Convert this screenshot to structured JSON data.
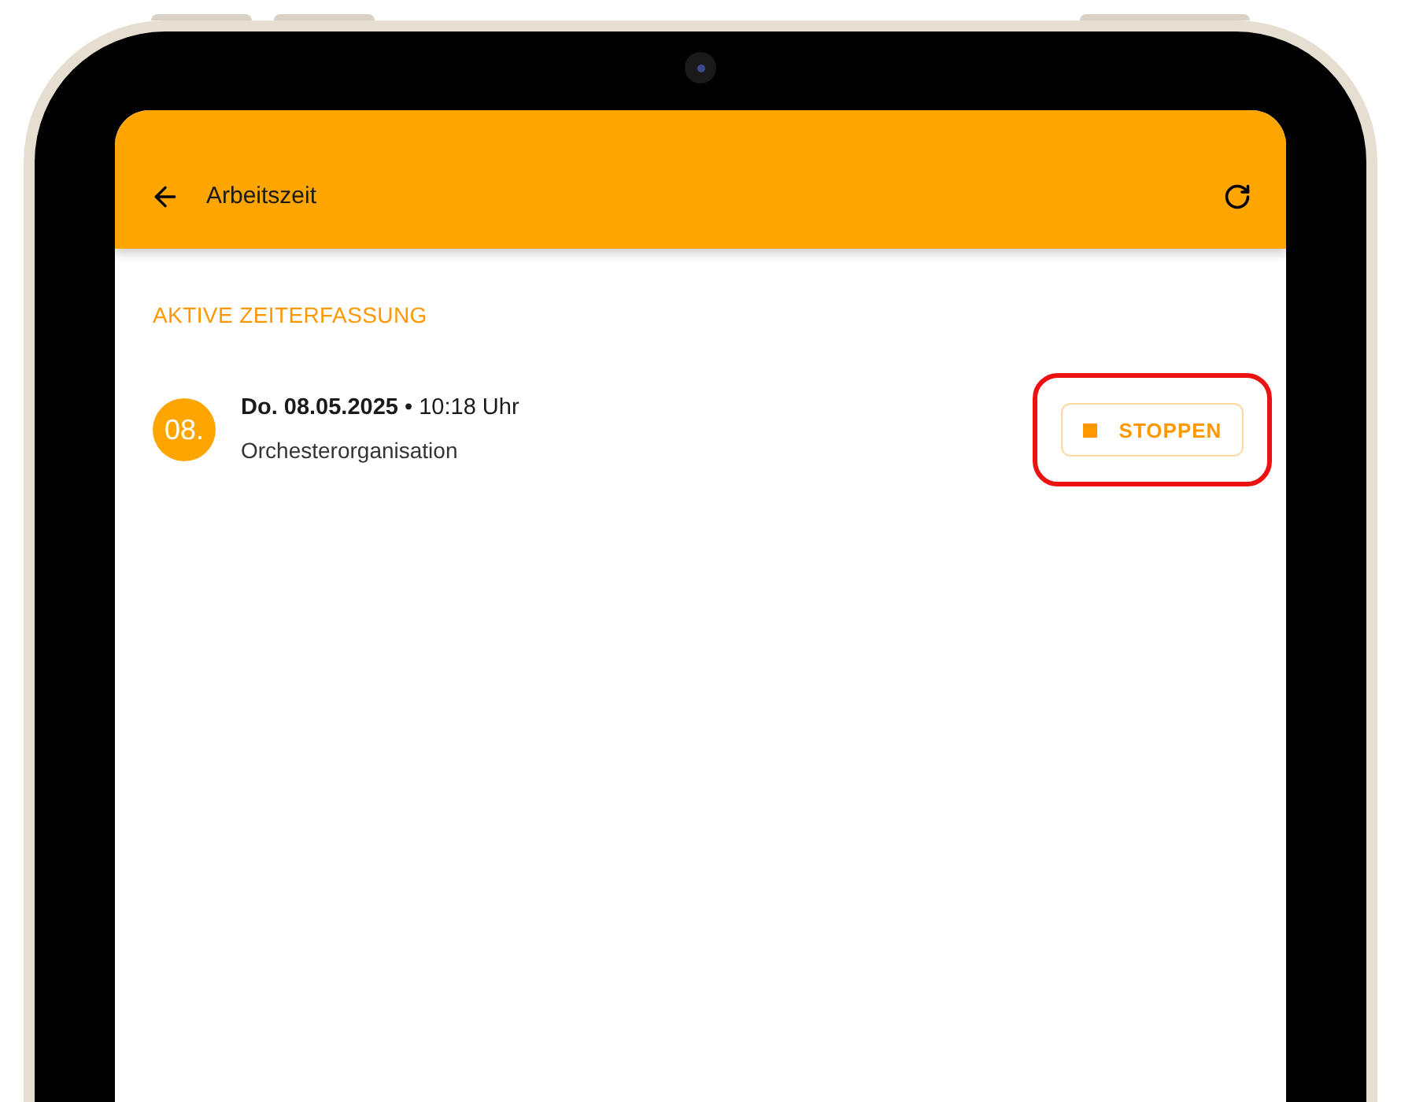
{
  "app_bar": {
    "title": "Arbeitszeit"
  },
  "section": {
    "title": "AKTIVE ZEITERFASSUNG"
  },
  "entries": [
    {
      "day": "08.",
      "heading": "**Do. 08.05.2025** • 10:18 Uhr",
      "subtitle": "Orchesterorganisation",
      "button": {
        "label": "STOPPEN",
        "highlighted": true
      }
    }
  ]
}
